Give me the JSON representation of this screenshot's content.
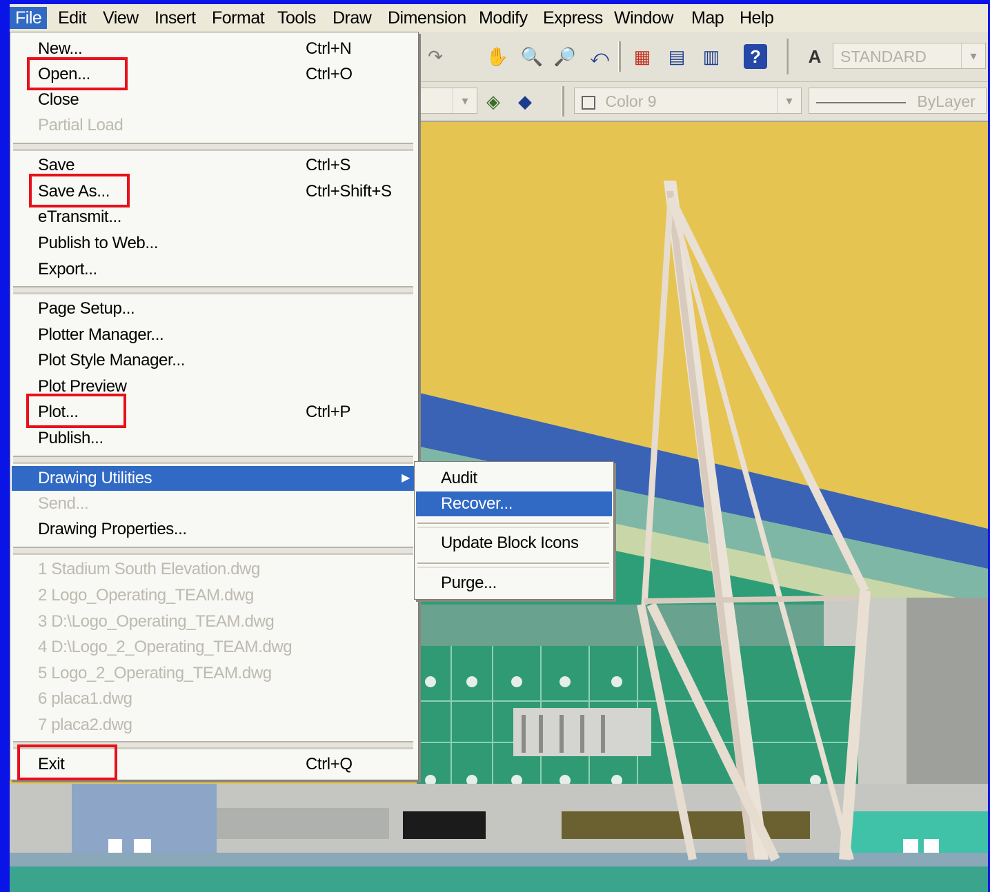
{
  "menubar": {
    "items": [
      "File",
      "Edit",
      "View",
      "Insert",
      "Format",
      "Tools",
      "Draw",
      "Dimension",
      "Modify",
      "Express",
      "Window",
      "Map",
      "Help"
    ],
    "active": "File"
  },
  "toolbar": {
    "text_style": "STANDARD",
    "color": "Color 9",
    "linetype": "ByLayer",
    "icons": [
      "undo-icon",
      "pan-icon",
      "zoom-realtime-icon",
      "zoom-window-icon",
      "zoom-previous-icon",
      "properties-icon",
      "design-center-icon",
      "tool-palettes-icon",
      "help-icon",
      "text-style-icon",
      "layer-icon",
      "layer-previous-icon"
    ]
  },
  "file_menu": {
    "groups": [
      [
        {
          "label": "New...",
          "shortcut": "Ctrl+N",
          "enabled": true
        },
        {
          "label": "Open...",
          "shortcut": "Ctrl+O",
          "enabled": true,
          "annotated": true
        },
        {
          "label": "Close",
          "shortcut": "",
          "enabled": true
        },
        {
          "label": "Partial Load",
          "shortcut": "",
          "enabled": false
        }
      ],
      [
        {
          "label": "Save",
          "shortcut": "Ctrl+S",
          "enabled": true
        },
        {
          "label": "Save As...",
          "shortcut": "Ctrl+Shift+S",
          "enabled": true,
          "annotated": true
        },
        {
          "label": "eTransmit...",
          "shortcut": "",
          "enabled": true
        },
        {
          "label": "Publish to Web...",
          "shortcut": "",
          "enabled": true
        },
        {
          "label": "Export...",
          "shortcut": "",
          "enabled": true
        }
      ],
      [
        {
          "label": "Page Setup...",
          "shortcut": "",
          "enabled": true
        },
        {
          "label": "Plotter Manager...",
          "shortcut": "",
          "enabled": true
        },
        {
          "label": "Plot Style Manager...",
          "shortcut": "",
          "enabled": true
        },
        {
          "label": "Plot Preview",
          "shortcut": "",
          "enabled": true
        },
        {
          "label": "Plot...",
          "shortcut": "Ctrl+P",
          "enabled": true,
          "annotated": true
        },
        {
          "label": "Publish...",
          "shortcut": "",
          "enabled": true
        }
      ],
      [
        {
          "label": "Drawing Utilities",
          "shortcut": "",
          "enabled": true,
          "highlighted": true,
          "submenu": true
        },
        {
          "label": "Send...",
          "shortcut": "",
          "enabled": false
        },
        {
          "label": "Drawing Properties...",
          "shortcut": "",
          "enabled": true
        }
      ],
      [
        {
          "label": "1 Stadium South Elevation.dwg",
          "shortcut": "",
          "enabled": false
        },
        {
          "label": "2 Logo_Operating_TEAM.dwg",
          "shortcut": "",
          "enabled": false
        },
        {
          "label": "3 D:\\Logo_Operating_TEAM.dwg",
          "shortcut": "",
          "enabled": false
        },
        {
          "label": "4 D:\\Logo_2_Operating_TEAM.dwg",
          "shortcut": "",
          "enabled": false
        },
        {
          "label": "5 Logo_2_Operating_TEAM.dwg",
          "shortcut": "",
          "enabled": false
        },
        {
          "label": "6 placa1.dwg",
          "shortcut": "",
          "enabled": false
        },
        {
          "label": "7 placa2.dwg",
          "shortcut": "",
          "enabled": false
        }
      ],
      [
        {
          "label": "Exit",
          "shortcut": "Ctrl+Q",
          "enabled": true,
          "annotated": true
        }
      ]
    ]
  },
  "drawing_utilities_submenu": {
    "groups": [
      [
        {
          "label": "Audit",
          "highlighted": false
        },
        {
          "label": "Recover...",
          "highlighted": true
        }
      ],
      [
        {
          "label": "Update Block Icons",
          "highlighted": false
        }
      ],
      [
        {
          "label": "Purge...",
          "highlighted": false
        }
      ]
    ]
  },
  "colors": {
    "desktop_blue": "#0a14e6",
    "menu_highlight": "#316ac5",
    "annotation_red": "#e8101a",
    "roof_yellow": "#e6c452",
    "stand_green": "#2e9e78",
    "mast_white": "#ece3d8"
  }
}
